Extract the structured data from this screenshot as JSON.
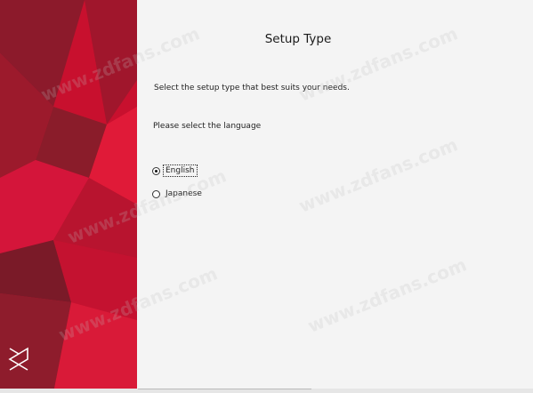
{
  "colors": {
    "panel_red": "#c8102e",
    "panel_dark": "#7a1a28",
    "background": "#f4f4f4"
  },
  "side_panel": {
    "logo_icon": "solidworks-logo-icon"
  },
  "main": {
    "title": "Setup Type",
    "instruction": "Select the setup type that best suits your needs.",
    "language_prompt": "Please select the language",
    "language_options": [
      {
        "label": "English",
        "selected": true
      },
      {
        "label": "Japanese",
        "selected": false
      }
    ]
  },
  "watermark": "www.zdfans.com"
}
